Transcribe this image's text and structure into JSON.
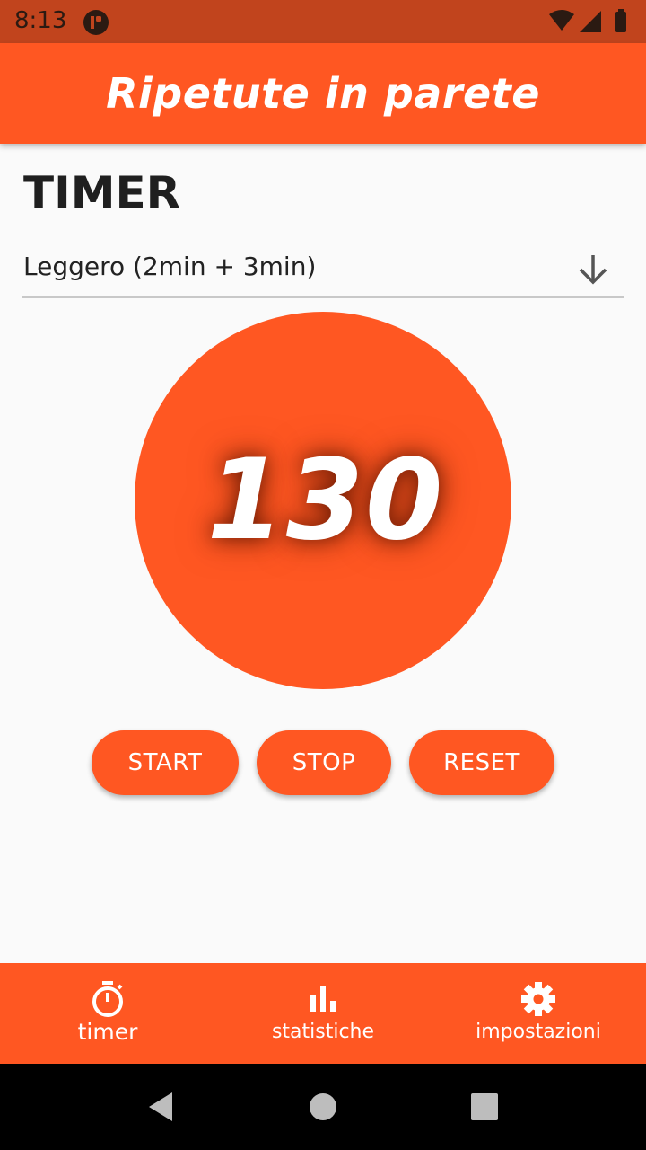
{
  "status_bar": {
    "time": "8:13",
    "icons": [
      "app-notification-icon",
      "wifi-icon",
      "signal-icon",
      "battery-icon"
    ]
  },
  "app_bar": {
    "title": "Ripetute in parete"
  },
  "main": {
    "section_title": "TIMER",
    "dropdown": {
      "selected": "Leggero (2min + 3min)",
      "icon": "arrow-down-icon"
    },
    "timer": {
      "value": "130"
    },
    "buttons": {
      "start": "START",
      "stop": "STOP",
      "reset": "RESET"
    }
  },
  "bottom_nav": {
    "items": [
      {
        "label": "timer",
        "icon": "stopwatch-icon",
        "selected": true
      },
      {
        "label": "statistiche",
        "icon": "bar-chart-icon",
        "selected": false
      },
      {
        "label": "impostazioni",
        "icon": "gear-icon",
        "selected": false
      }
    ]
  },
  "system_nav": {
    "icons": [
      "back-icon",
      "home-icon",
      "recents-icon"
    ]
  },
  "colors": {
    "accent": "#ff5722",
    "status_bar": "#c1441d",
    "background": "#fafafa",
    "system_nav": "#000000"
  }
}
